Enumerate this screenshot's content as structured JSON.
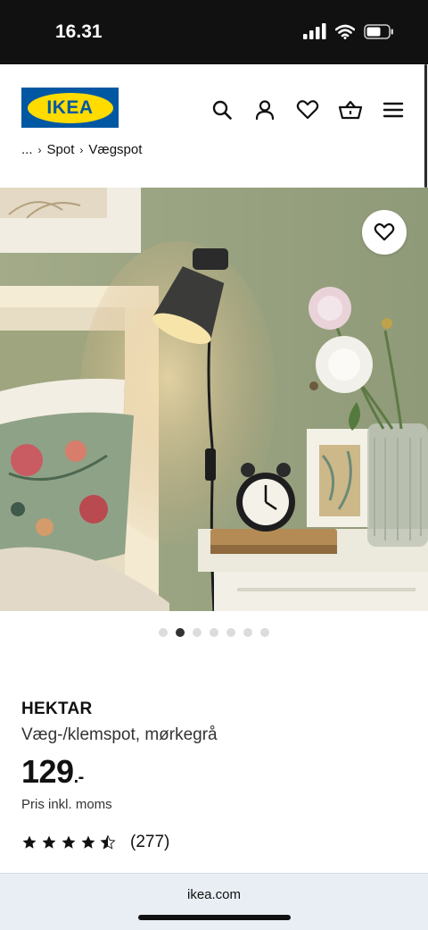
{
  "status_bar": {
    "time": "16.31"
  },
  "header": {
    "logo_text": "IKEA",
    "breadcrumb": [
      "...",
      "Spot",
      "Vægspot"
    ]
  },
  "hero": {
    "image_alt": "HEKTAR wall lamp on bedside table",
    "slide_count": 7,
    "active_slide": 2
  },
  "product": {
    "name": "HEKTAR",
    "description": "Væg-/klemspot, mørkegrå",
    "price": "129",
    "price_suffix": ".-",
    "price_note": "Pris inkl. moms",
    "rating": 4.5,
    "rating_max": 5,
    "review_count": "(277)"
  },
  "browser": {
    "url": "ikea.com"
  },
  "colors": {
    "ikea_blue": "#0058a3",
    "ikea_yellow": "#ffdb00"
  },
  "icons": [
    "signal-icon",
    "wifi-icon",
    "battery-icon",
    "search-icon",
    "user-icon",
    "heart-icon",
    "basket-icon",
    "menu-icon",
    "star-icon"
  ]
}
